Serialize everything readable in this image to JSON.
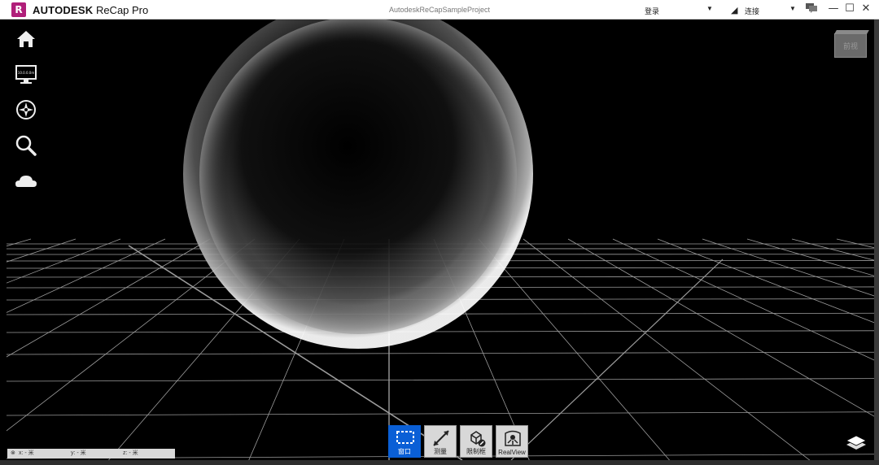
{
  "titlebar": {
    "logo_letter": "R",
    "brand": "AUTODESK",
    "product": "ReCap Pro",
    "project_name": "AutodeskReCapSampleProject",
    "login_label": "登录",
    "connect_label": "连接",
    "min_symbol": "—",
    "max_symbol": "☐",
    "close_symbol": "✕"
  },
  "left_toolbar": [
    {
      "icon": "home-icon"
    },
    {
      "icon": "display-settings-icon",
      "text": "10.0.0.0m"
    },
    {
      "icon": "navigation-compass-icon"
    },
    {
      "icon": "search-icon"
    },
    {
      "icon": "cloud-icon"
    }
  ],
  "viewcube": {
    "label": "前视"
  },
  "bottom_tools": [
    {
      "label": "窗口",
      "icon": "window-select-icon",
      "active": true
    },
    {
      "label": "测量",
      "icon": "measure-icon",
      "active": false
    },
    {
      "label": "限制框",
      "icon": "limit-box-icon",
      "active": false
    },
    {
      "label": "RealView",
      "icon": "realview-icon",
      "active": false
    }
  ],
  "coords": {
    "x": "x: - 米",
    "y": "y: - 米",
    "z": "z: - 米"
  },
  "colors": {
    "accent": "#0a5fd6",
    "logo": "#b01f7a",
    "viewport_bg": "#000000"
  }
}
